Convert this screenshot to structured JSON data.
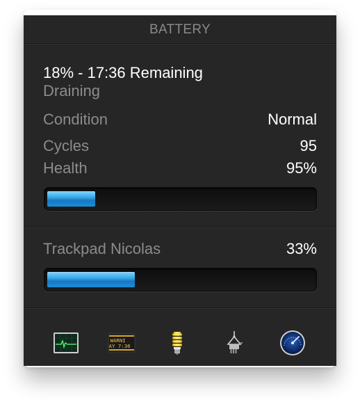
{
  "header": {
    "title": "BATTERY"
  },
  "battery": {
    "status": "18% - 17:36 Remaining",
    "state": "Draining",
    "condition_label": "Condition",
    "condition_value": "Normal",
    "cycles_label": "Cycles",
    "cycles_value": "95",
    "health_label": "Health",
    "health_value": "95%",
    "charge_level": 0.18
  },
  "trackpad": {
    "label": "Trackpad Nicolas",
    "value": "33%",
    "level": 0.33
  },
  "toolbar": {
    "items": [
      {
        "icon": "activity-monitor-icon"
      },
      {
        "icon": "console-icon",
        "line1": "WARNI",
        "line2": "AY 7:36"
      },
      {
        "icon": "lightbulb-icon"
      },
      {
        "icon": "usb-plug-icon"
      },
      {
        "icon": "speedometer-icon"
      }
    ]
  },
  "colors": {
    "panel": "#262626",
    "bar_fill": "#1c8ed8",
    "label_text": "#8c8c8c",
    "value_text": "#ffffff"
  }
}
